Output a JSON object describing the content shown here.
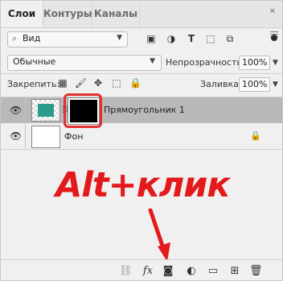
{
  "tabs": [
    {
      "label": "Слои",
      "active": true
    },
    {
      "label": "Контуры",
      "active": false
    },
    {
      "label": "Каналы",
      "active": false
    }
  ],
  "filter": {
    "label": "Вид",
    "icons": [
      "image-icon",
      "circle-half-icon",
      "text-icon",
      "shape-icon",
      "smartobject-icon"
    ]
  },
  "blend": {
    "mode": "Обычные",
    "opacity_label": "Непрозрачность:",
    "opacity_value": "100%"
  },
  "lock": {
    "label": "Закрепить:",
    "fill_label": "Заливка:",
    "fill_value": "100%"
  },
  "layers": [
    {
      "name": "Прямоугольник 1",
      "visible": true,
      "selected": true,
      "has_mask": true
    },
    {
      "name": "Фон",
      "visible": true,
      "selected": false,
      "locked": true
    }
  ],
  "annotation": {
    "text": "Alt+клик",
    "color": "#e3191b"
  },
  "bottom_icons": [
    "link-icon",
    "fx-icon",
    "add-mask-icon",
    "adjustment-icon",
    "group-folder-icon",
    "new-layer-icon",
    "trash-icon"
  ],
  "colors": {
    "accent_red": "#e3191b",
    "selected_row": "#b9b9b9",
    "teal": "#2d9b8a"
  }
}
